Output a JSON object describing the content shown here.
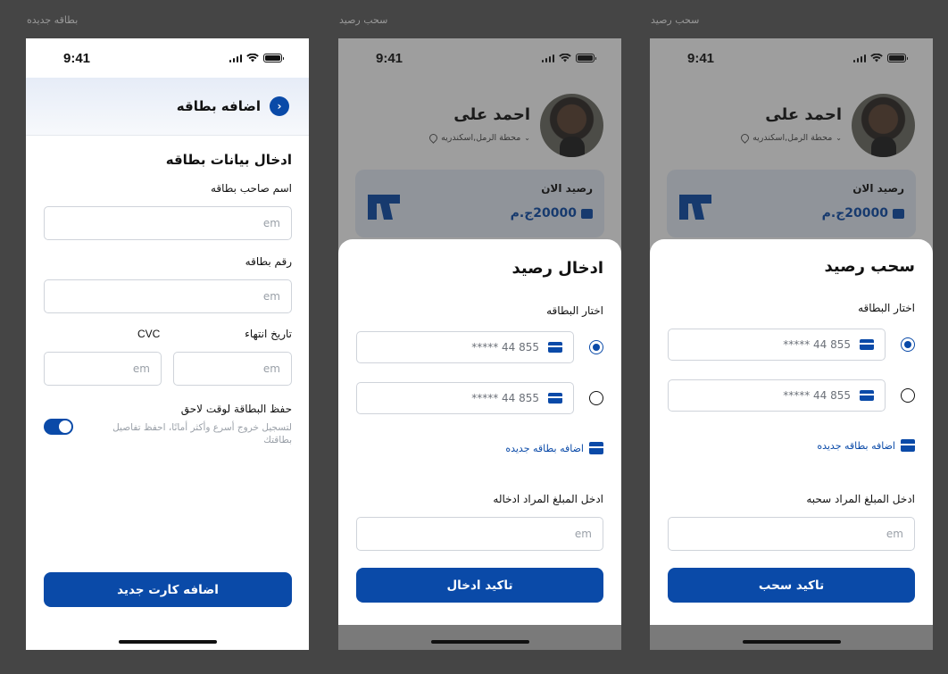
{
  "labels": {
    "frame1": "بطاقه جديده",
    "frame2": "سحب رصيد",
    "frame3": "سحب رصيد"
  },
  "status": {
    "time": "9:41"
  },
  "add_card": {
    "header_title": "اضافه بطاقه",
    "section_title": "ادخال بيانات بطاقه",
    "holder_label": "اسم صاحب بطاقه",
    "holder_placeholder": "em",
    "number_label": "رقم بطاقه",
    "number_placeholder": "em",
    "expiry_label": "تاريخ انتهاء",
    "expiry_placeholder": "em",
    "cvc_label": "CVC",
    "cvc_placeholder": "em",
    "save_title": "حفظ البطاقة لوقت لاحق",
    "save_desc": "لتسجيل خروج أسرع وأكثر أمانًا، احفظ تفاصيل بطاقتك",
    "submit": "اضافه كارت جديد"
  },
  "user": {
    "name": "احمد على",
    "location": "محطة الرمل,اسكندريه",
    "balance_label": "رصيد الان",
    "balance": "20000ج.م"
  },
  "deposit": {
    "title": "ادخال رصيد",
    "choose_card": "اختار البطاقه",
    "card1": "***** 44 855",
    "card2": "***** 44 855",
    "add_card": "اضافه بطاقه جديده",
    "amount_label": "ادخل المبلغ المراد ادخاله",
    "amount_placeholder": "em",
    "confirm": "تاكيد ادخال"
  },
  "withdraw": {
    "title": "سحب رصيد",
    "choose_card": "اختار البطاقه",
    "card1": "***** 44 855",
    "card2": "***** 44 855",
    "add_card": "اضافه بطاقه جديده",
    "amount_label": "ادخل المبلغ المراد سحبه",
    "amount_placeholder": "em",
    "confirm": "تاكيد سحب"
  },
  "colors": {
    "accent": "#0a4aa8",
    "background": "#454545"
  }
}
